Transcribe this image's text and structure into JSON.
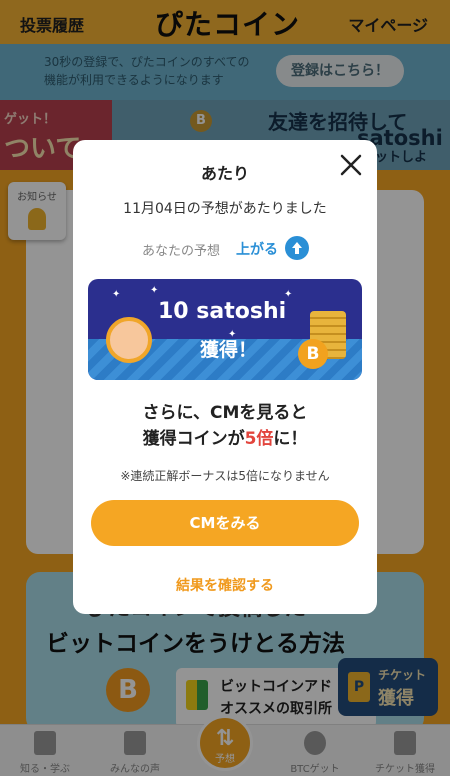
{
  "header": {
    "left_link": "投票履歴",
    "logo": "ぴたコイン",
    "right_link": "マイページ"
  },
  "registration": {
    "text": "30秒の登録で、ぴたコインのすべての機能が利用できるようになります",
    "button": "登録はこちら！"
  },
  "banners": {
    "left_line1": "ゲット！",
    "left_line2": "ついて",
    "right_coin": "B",
    "right_line1": "友達を招待して",
    "right_line2": "satoshi",
    "right_line3": "ゲットしよ"
  },
  "notice": {
    "label": "お知らせ"
  },
  "promo": {
    "line1": "ぴたコインで投稿した",
    "line2": "ビットコインをうけとる方法",
    "btc_symbol": "B",
    "card_line1": "ビットコインアド",
    "card_line2": "オススメの取引所",
    "ticket_line1": "チケット",
    "ticket_line2": "獲得",
    "ticket_icon": "P"
  },
  "nav": {
    "items": [
      {
        "label": "知る・学ぶ",
        "icon": "book-icon"
      },
      {
        "label": "みんなの声",
        "icon": "chat-icon"
      },
      {
        "label": "予想",
        "icon": "updown-arrows-icon"
      },
      {
        "label": "BTCゲット",
        "icon": "bitcoin-icon"
      },
      {
        "label": "チケット獲得",
        "icon": "phone-icon"
      }
    ],
    "center_arrows": "⇅"
  },
  "modal": {
    "title": "あたり",
    "message": "11月04日の予想があたりました",
    "prediction_label": "あなたの予想",
    "prediction_value": "上がる",
    "reward_amount": "10 satoshi",
    "reward_label": "獲得！",
    "reward_btc_symbol": "B",
    "cm_line1": "さらに、CMを見ると",
    "cm_line2_a": "獲得コインが",
    "cm_line2_b": "5倍",
    "cm_line2_c": "に！",
    "note": "※連続正解ボーナスは5倍になりません",
    "cm_button": "CMをみる",
    "result_link": "結果を確認する"
  },
  "colors": {
    "brand_orange": "#f5a623",
    "link_blue": "#2a8fd6",
    "emphasis_red": "#e2453d"
  }
}
